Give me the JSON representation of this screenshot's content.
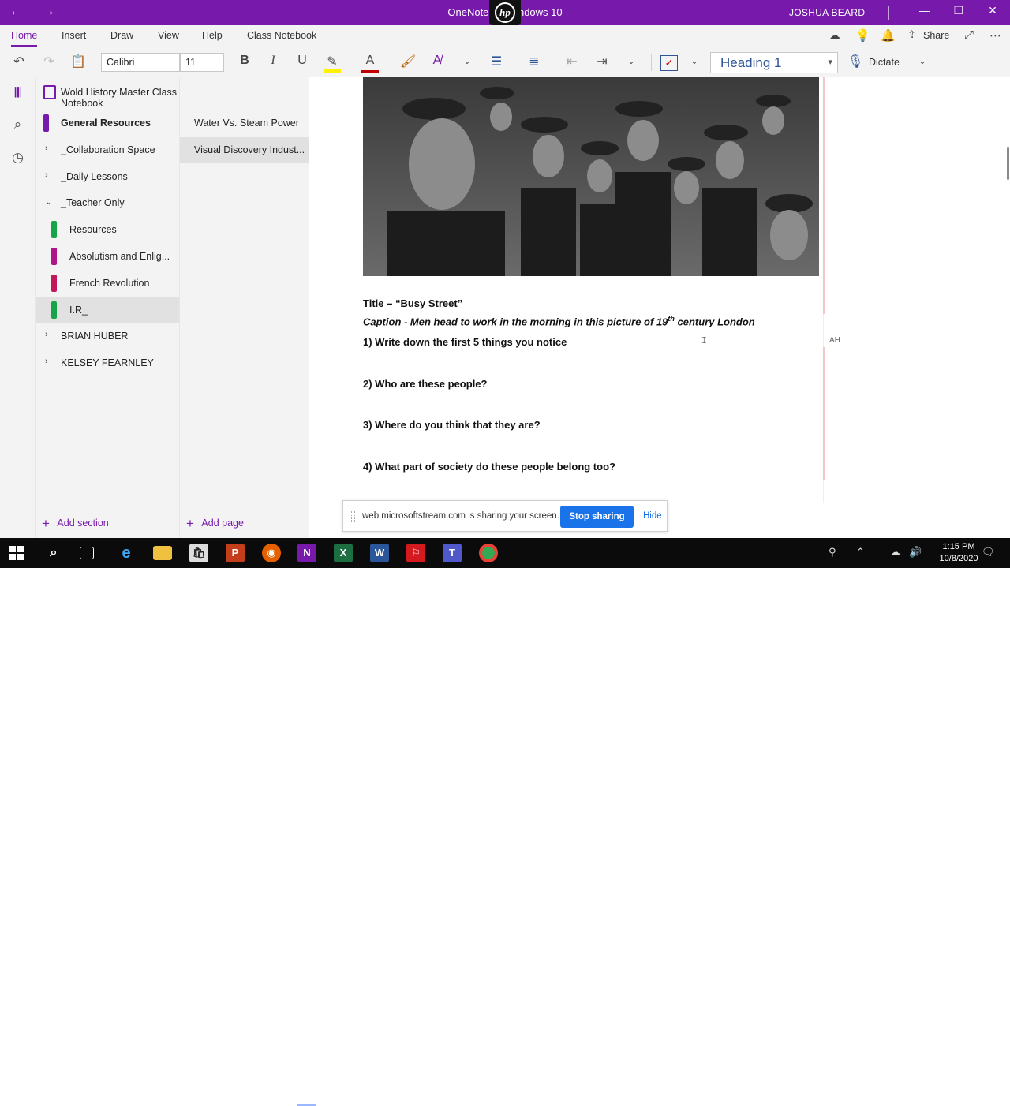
{
  "titlebar": {
    "title": "OneNote for Windows 10",
    "user": "JOSHUA  BEARD",
    "hp_logo": "hp"
  },
  "ribbon": {
    "tabs": [
      "Home",
      "Insert",
      "Draw",
      "View",
      "Help",
      "Class Notebook"
    ],
    "active_tab": "Home",
    "share_label": "Share",
    "font_name": "Calibri",
    "font_size": "11",
    "style": "Heading 1",
    "dictate_label": "Dictate",
    "accent_color": "#7719aa"
  },
  "notebook": {
    "title": "Wold History Master Class Notebook",
    "sections": [
      {
        "label": "General Resources",
        "color": "#7719aa",
        "level": 0,
        "expander": "",
        "bold": true
      },
      {
        "label": "_Collaboration Space",
        "color": "",
        "level": 0,
        "expander": ">",
        "bold": false
      },
      {
        "label": "_Daily Lessons",
        "color": "",
        "level": 0,
        "expander": ">",
        "bold": false
      },
      {
        "label": "_Teacher Only",
        "color": "",
        "level": 0,
        "expander": "v",
        "bold": false
      },
      {
        "label": "Resources",
        "color": "#16a34a",
        "level": 1,
        "expander": "",
        "bold": false
      },
      {
        "label": "Absolutism and Enlig...",
        "color": "#b0158a",
        "level": 1,
        "expander": "",
        "bold": false
      },
      {
        "label": "French Revolution",
        "color": "#c2185b",
        "level": 1,
        "expander": "",
        "bold": false
      },
      {
        "label": "I.R_",
        "color": "#16a34a",
        "level": 1,
        "expander": "",
        "bold": false
      },
      {
        "label": "BRIAN  HUBER",
        "color": "",
        "level": 0,
        "expander": ">",
        "bold": false
      },
      {
        "label": "KELSEY  FEARNLEY",
        "color": "",
        "level": 0,
        "expander": ">",
        "bold": false
      }
    ],
    "selected_section": "I.R_",
    "add_section_label": "Add section"
  },
  "pages": {
    "items": [
      "Water Vs. Steam Power",
      "Visual Discovery Indust..."
    ],
    "selected": "Visual Discovery Indust...",
    "add_page_label": "Add page"
  },
  "page_content": {
    "title_line": "Title – “Busy Street”",
    "caption_prefix": "Caption - Men head to work in the morning in this picture of 19",
    "caption_sup": "th",
    "caption_suffix": " century London",
    "questions": [
      "1) Write down the first 5 things you notice",
      "2) Who are these people?",
      "3) Where do you think that they are?",
      "4) What part of society do these people belong too?"
    ],
    "author_initials": "AH"
  },
  "share_banner": {
    "message": "web.microsoftstream.com is sharing your screen.",
    "stop_label": "Stop sharing",
    "hide_label": "Hide"
  },
  "taskbar": {
    "time": "1:15 PM",
    "date": "10/8/2020",
    "apps": [
      "windows-start",
      "search",
      "task-view",
      "edge",
      "file-explorer",
      "store",
      "powerpoint",
      "firefox",
      "onenote",
      "excel",
      "word",
      "acrobat",
      "teams",
      "chrome"
    ]
  }
}
